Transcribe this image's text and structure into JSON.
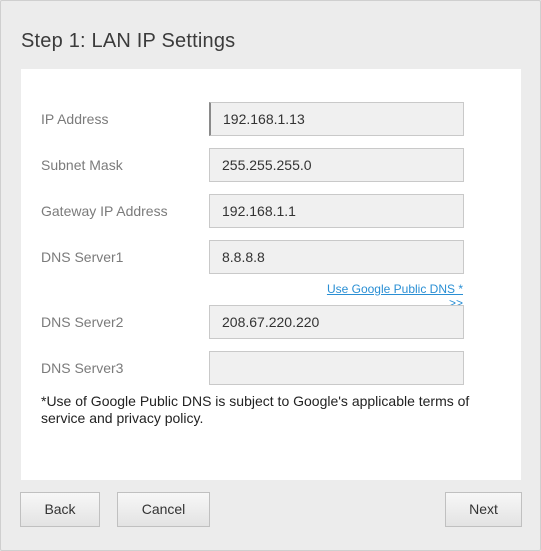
{
  "page": {
    "title": "Step 1: LAN IP Settings"
  },
  "form": {
    "ip_address": {
      "label": "IP Address",
      "value": "192.168.1.13"
    },
    "subnet_mask": {
      "label": "Subnet Mask",
      "value": "255.255.255.0"
    },
    "gateway": {
      "label": "Gateway IP Address",
      "value": "192.168.1.1"
    },
    "dns1": {
      "label": "DNS Server1",
      "value": "8.8.8.8"
    },
    "google_dns_link": "Use Google Public DNS * >>",
    "dns2": {
      "label": "DNS Server2",
      "value": "208.67.220.220"
    },
    "dns3": {
      "label": "DNS Server3",
      "value": ""
    },
    "note": "*Use of Google Public DNS is subject to Google's applicable terms of service and privacy policy."
  },
  "buttons": {
    "back": "Back",
    "cancel": "Cancel",
    "next": "Next"
  },
  "colors": {
    "background": "#ececec",
    "panel": "#ffffff",
    "link": "#2a8fd4",
    "field_bg": "#f0f0f0"
  }
}
